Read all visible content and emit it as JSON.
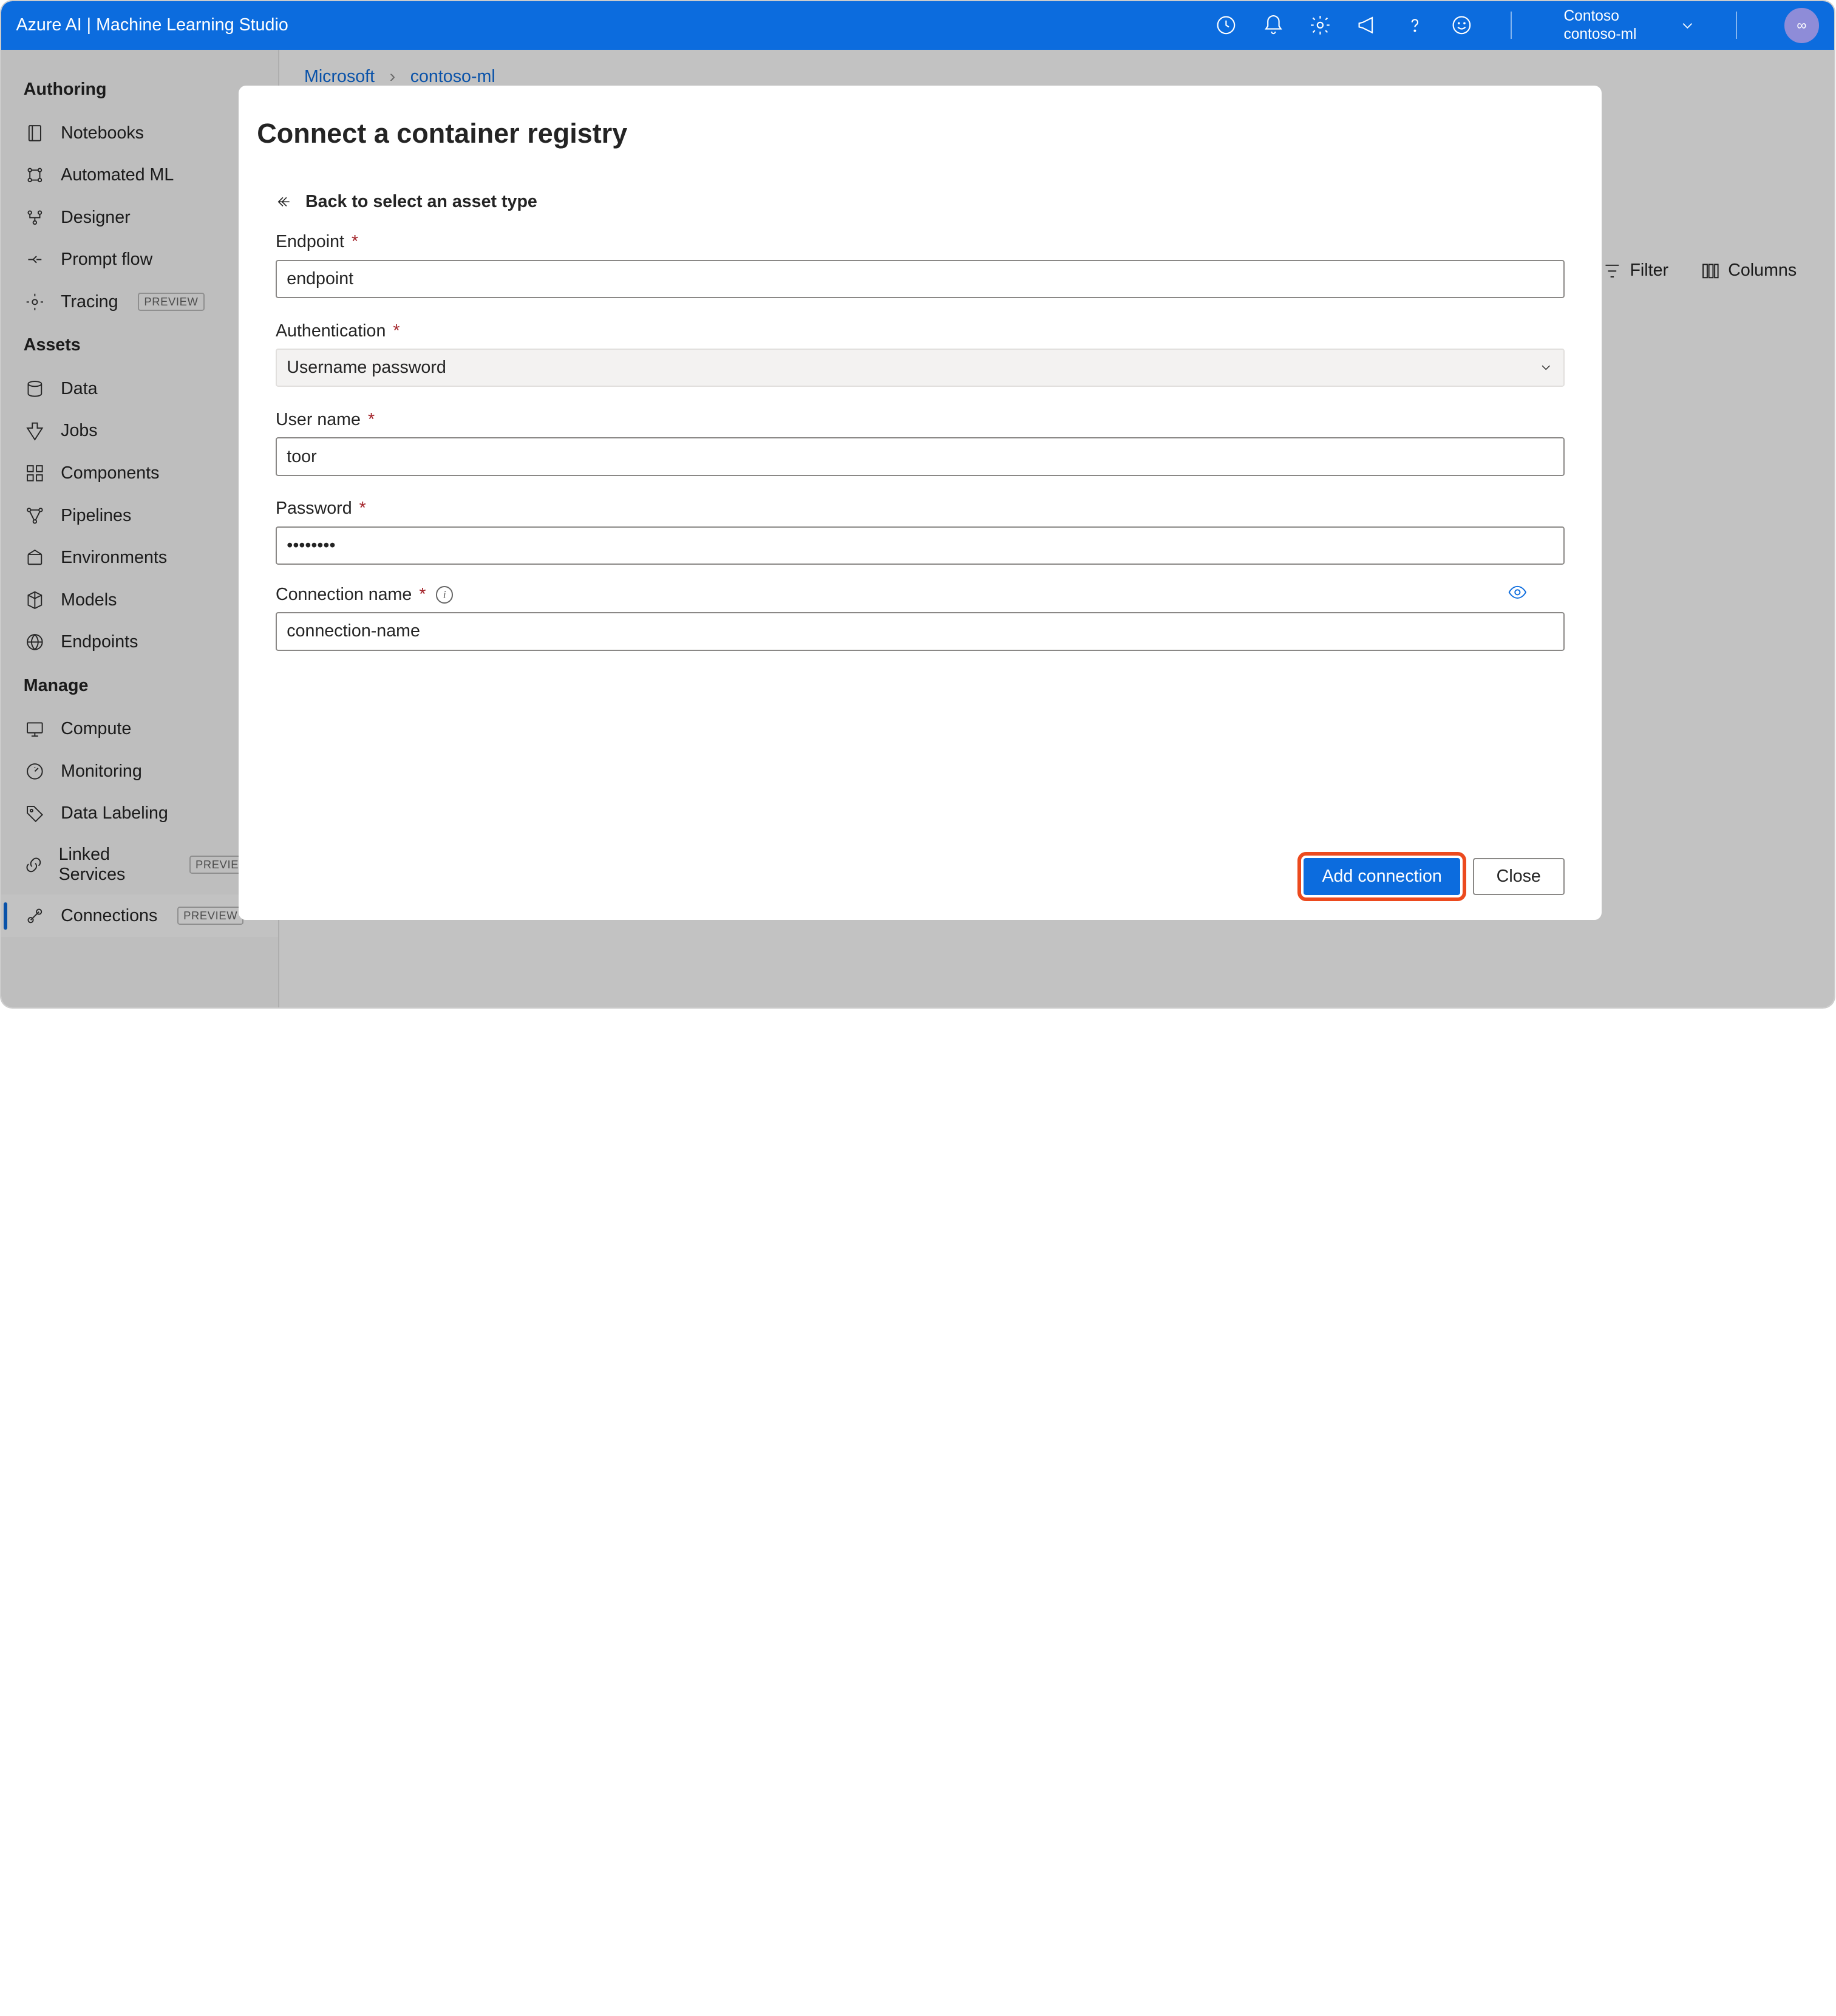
{
  "topbar": {
    "title": "Azure AI | Machine Learning Studio",
    "account_name": "Contoso",
    "workspace": "contoso-ml",
    "avatar": "∞"
  },
  "breadcrumb": {
    "root": "Microsoft",
    "workspace": "contoso-ml"
  },
  "sidebar": {
    "sections": [
      {
        "header": "Authoring",
        "items": [
          {
            "label": "Notebooks",
            "icon": "notebook"
          },
          {
            "label": "Automated ML",
            "icon": "automl"
          },
          {
            "label": "Designer",
            "icon": "designer"
          },
          {
            "label": "Prompt flow",
            "icon": "promptflow"
          },
          {
            "label": "Tracing",
            "icon": "tracing",
            "badge": "PREVIEW"
          }
        ]
      },
      {
        "header": "Assets",
        "items": [
          {
            "label": "Data",
            "icon": "data"
          },
          {
            "label": "Jobs",
            "icon": "jobs"
          },
          {
            "label": "Components",
            "icon": "components"
          },
          {
            "label": "Pipelines",
            "icon": "pipelines"
          },
          {
            "label": "Environments",
            "icon": "environments"
          },
          {
            "label": "Models",
            "icon": "models"
          },
          {
            "label": "Endpoints",
            "icon": "endpoints"
          }
        ]
      },
      {
        "header": "Manage",
        "items": [
          {
            "label": "Compute",
            "icon": "compute"
          },
          {
            "label": "Monitoring",
            "icon": "monitoring"
          },
          {
            "label": "Data Labeling",
            "icon": "datalabeling"
          },
          {
            "label": "Linked Services",
            "icon": "linked",
            "badge": "PREVIEW"
          },
          {
            "label": "Connections",
            "icon": "connections",
            "badge": "PREVIEW",
            "active": true
          }
        ]
      }
    ]
  },
  "toolbar": {
    "filter": "Filter",
    "columns": "Columns"
  },
  "dialog": {
    "title": "Connect a container registry",
    "back": "Back to select an asset type",
    "endpoint_label": "Endpoint",
    "endpoint_value": "endpoint",
    "auth_label": "Authentication",
    "auth_value": "Username password",
    "username_label": "User name",
    "username_value": "toor",
    "password_label": "Password",
    "password_value": "••••••••",
    "conn_label": "Connection name",
    "conn_value": "connection-name",
    "primary": "Add connection",
    "secondary": "Close"
  }
}
